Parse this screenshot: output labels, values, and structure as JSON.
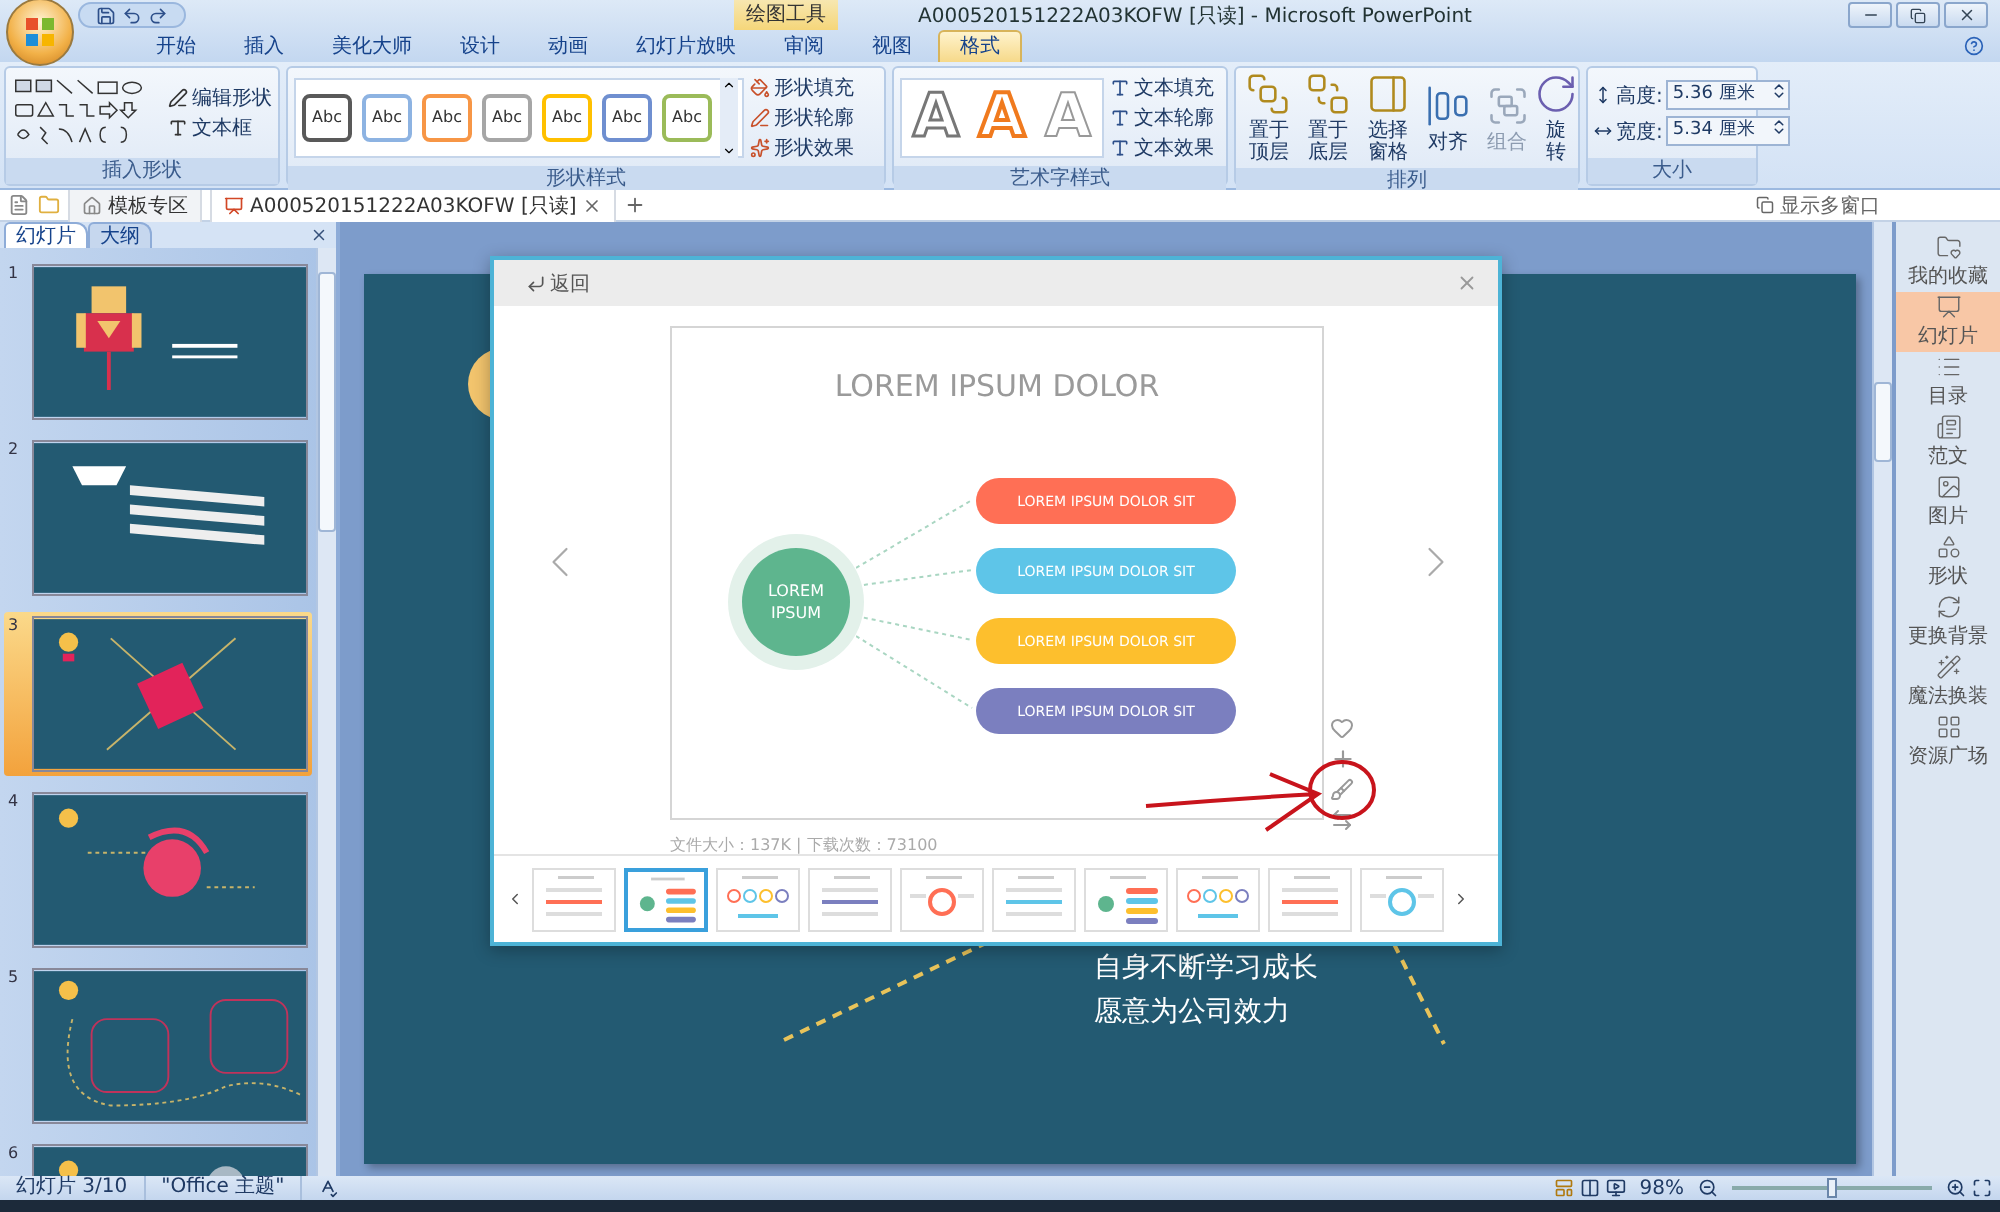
{
  "title_bar": {
    "contextual_tab": "绘图工具",
    "title": "A000520151222A03KOFW [只读] - Microsoft PowerPoint"
  },
  "ribbon_tabs": [
    {
      "label": "开始",
      "selected": false
    },
    {
      "label": "插入",
      "selected": false
    },
    {
      "label": "美化大师",
      "selected": false
    },
    {
      "label": "设计",
      "selected": false
    },
    {
      "label": "动画",
      "selected": false
    },
    {
      "label": "幻灯片放映",
      "selected": false
    },
    {
      "label": "审阅",
      "selected": false
    },
    {
      "label": "视图",
      "selected": false
    },
    {
      "label": "格式",
      "selected": true
    }
  ],
  "insert_shapes": {
    "label": "插入形状",
    "commands": [
      "编辑形状",
      "文本框"
    ]
  },
  "shape_styles": {
    "label": "形状样式",
    "presets": [
      {
        "label": "Abc",
        "color": "#595959"
      },
      {
        "label": "Abc",
        "color": "#8db3e2"
      },
      {
        "label": "Abc",
        "color": "#f79646"
      },
      {
        "label": "Abc",
        "color": "#a6a6a6"
      },
      {
        "label": "Abc",
        "color": "#ffc000"
      },
      {
        "label": "Abc",
        "color": "#6f8fd0"
      },
      {
        "label": "Abc",
        "color": "#9bbb59"
      }
    ],
    "commands": [
      "形状填充",
      "形状轮廓",
      "形状效果"
    ]
  },
  "wordart_styles": {
    "label": "艺术字样式",
    "presets": [
      {
        "label": "A",
        "kind": "outline"
      },
      {
        "label": "A",
        "kind": "orange"
      },
      {
        "label": "A",
        "kind": "white"
      }
    ],
    "commands": [
      "文本填充",
      "文本轮廓",
      "文本效果"
    ]
  },
  "arrange": {
    "label": "排列",
    "commands": [
      {
        "label": "置于顶层",
        "kind": "front",
        "disabled": false
      },
      {
        "label": "置于底层",
        "kind": "back",
        "disabled": false
      },
      {
        "label": "选择窗格",
        "kind": "pane",
        "disabled": false
      },
      {
        "label": "对齐",
        "kind": "align",
        "disabled": false
      },
      {
        "label": "组合",
        "kind": "group",
        "disabled": true
      },
      {
        "label": "旋转",
        "kind": "rotate",
        "disabled": false
      }
    ]
  },
  "size": {
    "label": "大小",
    "fields": [
      {
        "label": "高度:",
        "value": "5.36 厘米"
      },
      {
        "label": "宽度:",
        "value": "5.34 厘米"
      }
    ]
  },
  "doc_tabs": [
    {
      "label": "模板专区",
      "kind": "home",
      "selected": false
    },
    {
      "label": "A000520151222A03KOFW [只读]",
      "kind": "file",
      "selected": true
    }
  ],
  "multi_window": "显示多窗口",
  "slide_panel": {
    "tabs": [
      {
        "label": "幻灯片",
        "selected": true
      },
      {
        "label": "大纲",
        "selected": false
      }
    ],
    "slides": [
      {
        "number": "1",
        "kind": "hero",
        "selected": false
      },
      {
        "number": "2",
        "kind": "list",
        "selected": false
      },
      {
        "number": "3",
        "kind": "swot",
        "selected": true
      },
      {
        "number": "4",
        "kind": "sphere",
        "selected": false
      },
      {
        "number": "5",
        "kind": "path",
        "selected": false
      },
      {
        "number": "6",
        "kind": "partial",
        "selected": false
      }
    ]
  },
  "slide_text": [
    "自身不断学习成长",
    "愿意为公司效力"
  ],
  "dialog": {
    "back": "返回",
    "preview": {
      "title": "LOREM IPSUM DOLOR",
      "center": "LOREM IPSUM",
      "items": [
        {
          "label": "LOREM IPSUM DOLOR SIT",
          "color": "#ff6f55"
        },
        {
          "label": "LOREM IPSUM DOLOR SIT",
          "color": "#5ec5e8"
        },
        {
          "label": "LOREM IPSUM DOLOR SIT",
          "color": "#fdbf2d"
        },
        {
          "label": "LOREM IPSUM DOLOR SIT",
          "color": "#7b7fbf"
        }
      ]
    },
    "info": "文件大小：137K | 下载次数：73100",
    "thumbnails": [
      {
        "selected": false
      },
      {
        "selected": true
      },
      {
        "selected": false
      },
      {
        "selected": false
      },
      {
        "selected": false
      },
      {
        "selected": false
      },
      {
        "selected": false
      },
      {
        "selected": false
      },
      {
        "selected": false
      },
      {
        "selected": false
      }
    ]
  },
  "sidebar": [
    {
      "label": "我的收藏",
      "selected": false
    },
    {
      "label": "幻灯片",
      "selected": true
    },
    {
      "label": "目录",
      "selected": false
    },
    {
      "label": "范文",
      "selected": false
    },
    {
      "label": "图片",
      "selected": false
    },
    {
      "label": "形状",
      "selected": false
    },
    {
      "label": "更换背景",
      "selected": false
    },
    {
      "label": "魔法换装",
      "selected": false
    },
    {
      "label": "资源广场",
      "selected": false
    }
  ],
  "status_bar": {
    "slide": "幻灯片 3/10",
    "theme": "\"Office 主题\"",
    "zoom": "98%",
    "zoom_slider": {
      "level": 0.5
    }
  }
}
